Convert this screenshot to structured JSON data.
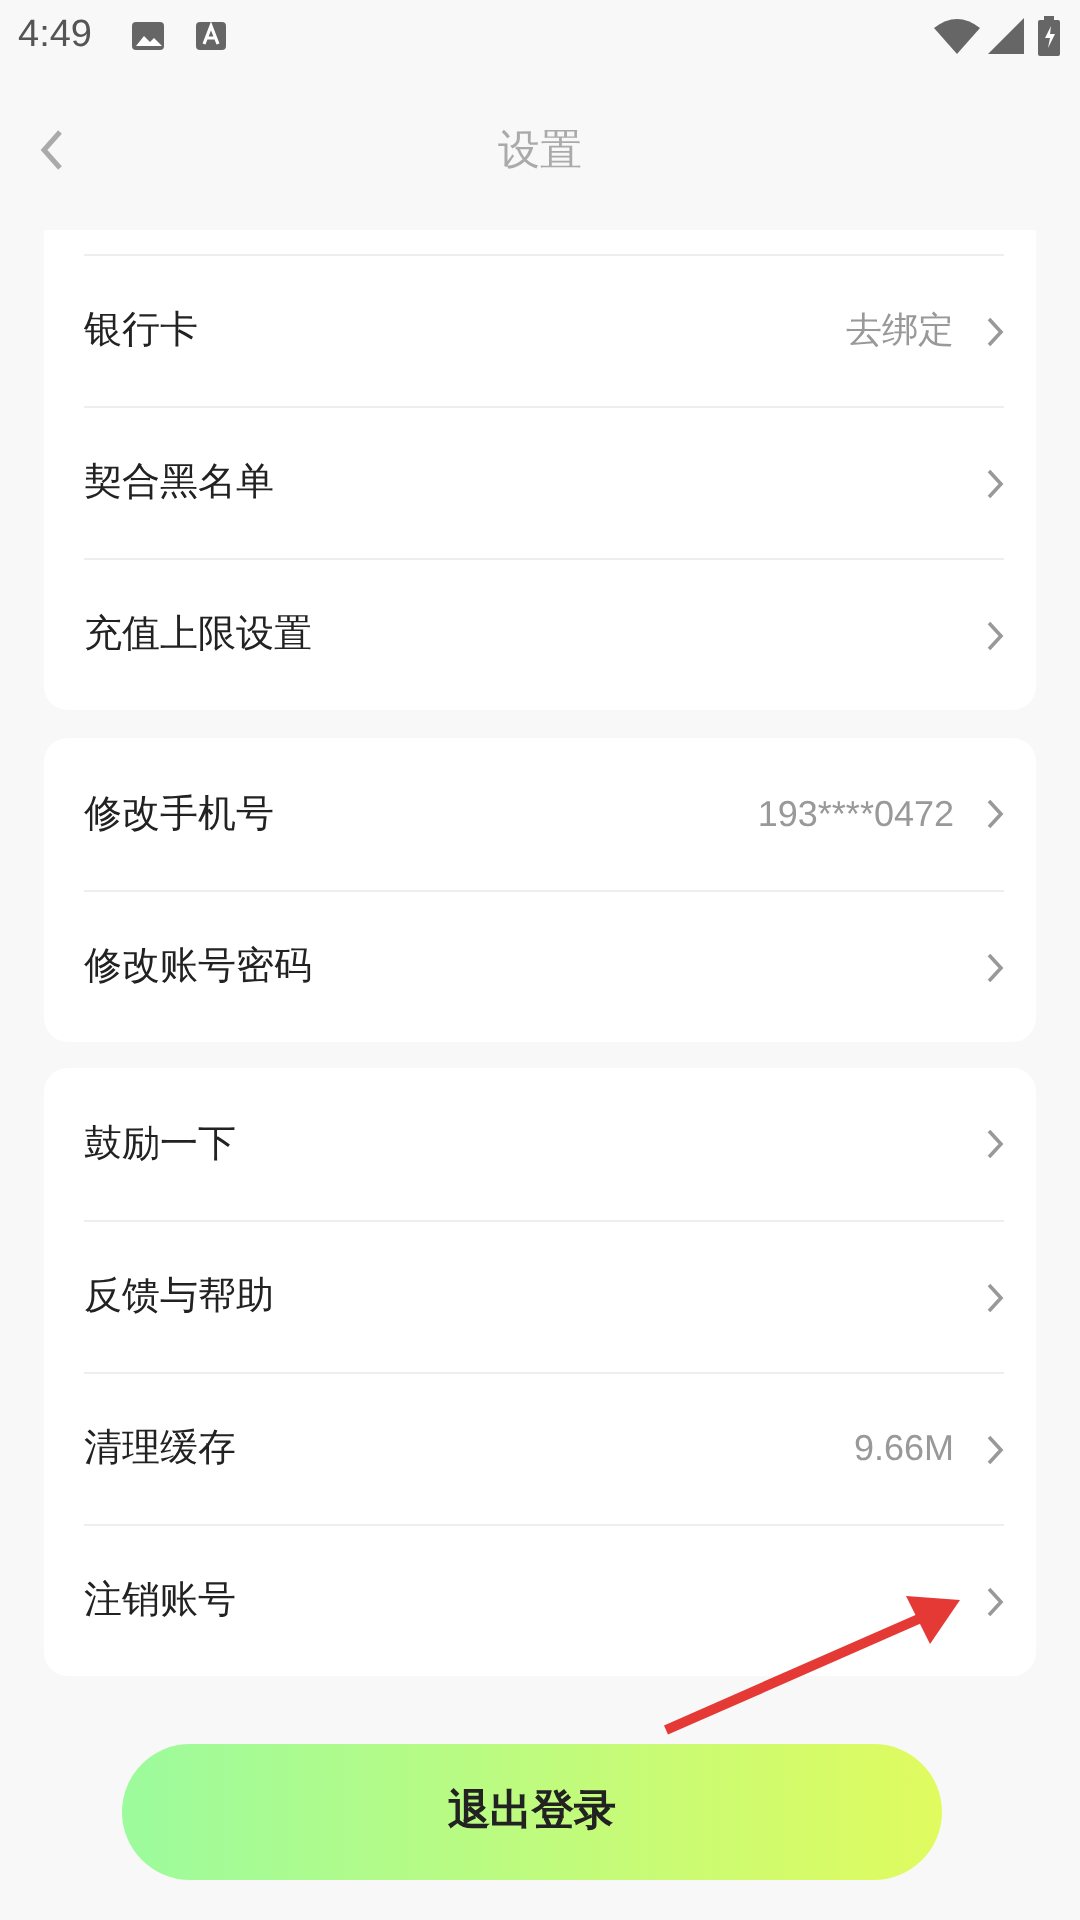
{
  "status_bar": {
    "time": "4:49"
  },
  "header": {
    "title": "设置"
  },
  "sections": [
    {
      "items": [
        {
          "label": "银行卡",
          "value": "去绑定"
        },
        {
          "label": "契合黑名单"
        },
        {
          "label": "充值上限设置"
        }
      ]
    },
    {
      "items": [
        {
          "label": "修改手机号",
          "value": "193****0472"
        },
        {
          "label": "修改账号密码"
        }
      ]
    },
    {
      "items": [
        {
          "label": "鼓励一下"
        },
        {
          "label": "反馈与帮助"
        },
        {
          "label": "清理缓存",
          "value": "9.66M"
        },
        {
          "label": "注销账号"
        }
      ]
    }
  ],
  "logout_button": {
    "label": "退出登录"
  }
}
